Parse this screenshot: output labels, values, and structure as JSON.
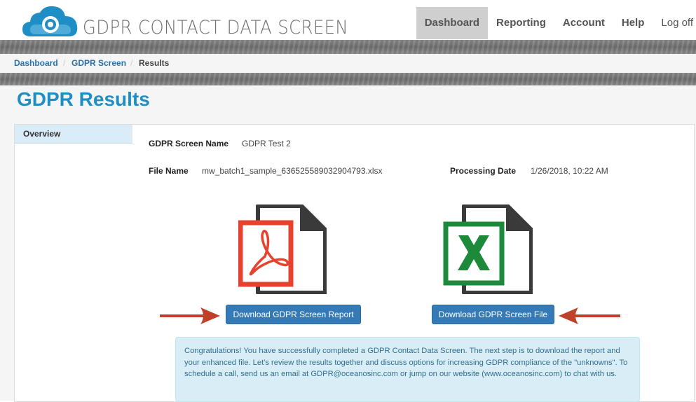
{
  "header": {
    "brand": "GDPR CONTACT DATA SCREEN",
    "nav": [
      {
        "label": "Dashboard",
        "active": true
      },
      {
        "label": "Reporting",
        "active": false
      },
      {
        "label": "Account",
        "active": false
      },
      {
        "label": "Help",
        "active": false
      },
      {
        "label": "Log off",
        "active": false
      }
    ]
  },
  "breadcrumb": {
    "dashboard": "Dashboard",
    "gdpr_screen": "GDPR Screen",
    "current": "Results",
    "separator": "/"
  },
  "page_title": "GDPR Results",
  "sidebar": {
    "items": [
      {
        "label": "Overview"
      }
    ]
  },
  "details": {
    "screen_name_label": "GDPR Screen Name",
    "screen_name_value": "GDPR Test 2",
    "file_name_label": "File Name",
    "file_name_value": "mw_batch1_sample_636525589032904793.xlsx",
    "processing_date_label": "Processing Date",
    "processing_date_value": "1/26/2018, 10:22 AM"
  },
  "downloads": {
    "report_label": "Download GDPR Screen Report",
    "file_label": "Download GDPR Screen File",
    "report_icon": "pdf-file-icon",
    "file_icon": "excel-file-icon"
  },
  "message": "Congratulations! You have successfully completed a GDPR Contact Data Screen. The next step is to download the report and your enhanced file. Let's review the results together and discuss options for increasing GDPR compliance of the \"unknowns\". To schedule a call, send us an email at GDPR@oceanosinc.com or jump on our website (www.oceanosinc.com) to chat with us.",
  "colors": {
    "accent": "#1e8ec4",
    "button": "#337ab7",
    "pdf_red": "#e5432f",
    "excel_green": "#1d8a3b",
    "arrow": "#c0412a"
  }
}
